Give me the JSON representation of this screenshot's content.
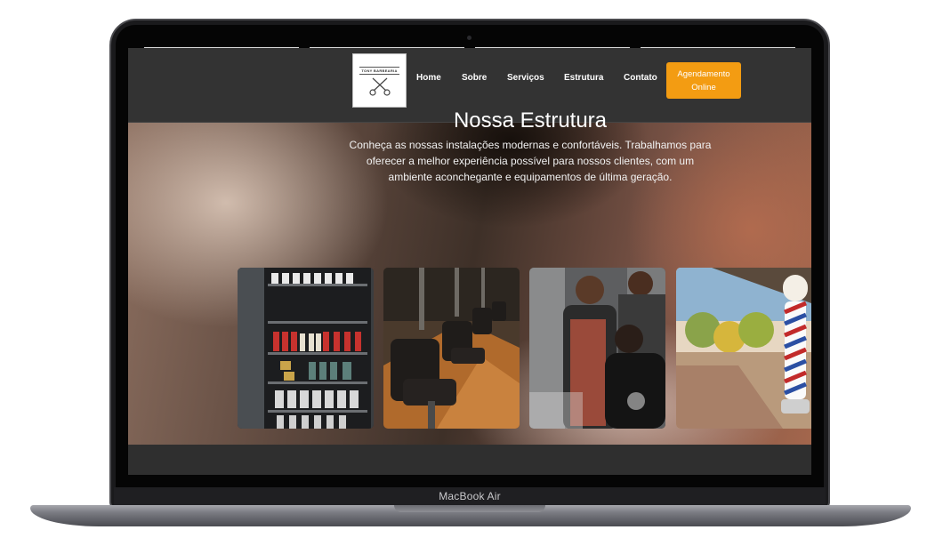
{
  "device": {
    "label": "MacBook Air"
  },
  "site": {
    "logo": {
      "text": "TONY BARBEARIA",
      "icon": "scissors-icon"
    },
    "nav": [
      {
        "label": "Home"
      },
      {
        "label": "Sobre"
      },
      {
        "label": "Serviços"
      },
      {
        "label": "Estrutura"
      },
      {
        "label": "Contato"
      }
    ],
    "cta": {
      "label": "Agendamento Online",
      "color": "#f39c12"
    }
  },
  "hero": {
    "title": "Nossa Estrutura",
    "text": "Conheça as nossas instalações modernas e confortáveis. Trabalhamos para oferecer a melhor experiência possível para nossos clientes, com um ambiente aconchegante e equipamentos de última geração."
  },
  "gallery": [
    {
      "subject": "product-shelf-photo"
    },
    {
      "subject": "barber-chairs-photo"
    },
    {
      "subject": "barber-cutting-hair-photo"
    },
    {
      "subject": "barber-pole-photo"
    }
  ]
}
